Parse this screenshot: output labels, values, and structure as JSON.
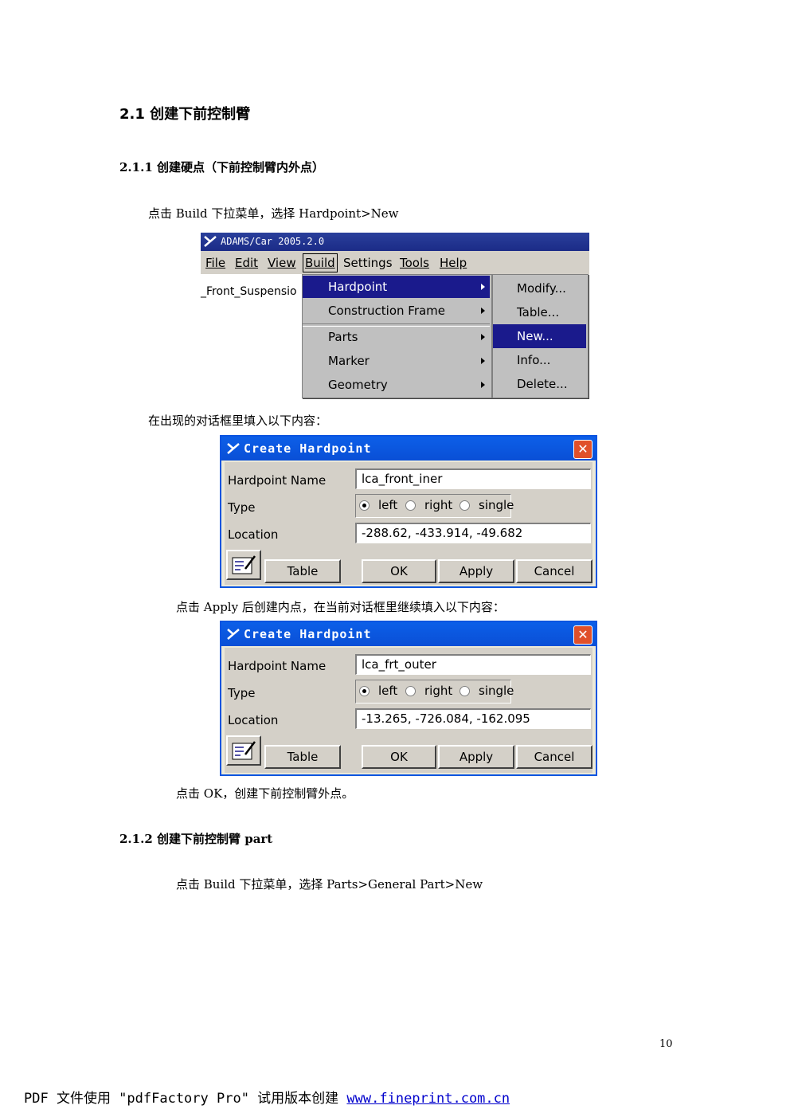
{
  "section": {
    "title": "2.1 创建下前控制臂"
  },
  "sub1": {
    "title": "2.1.1 创建硬点（下前控制臂内外点）",
    "instruction": "点击 Build 下拉菜单，选择 Hardpoint>New"
  },
  "menu_shot": {
    "window_title": "ADAMS/Car 2005.2.0",
    "menubar": [
      "File",
      "Edit",
      "View",
      "Build",
      "Settings",
      "Tools",
      "Help"
    ],
    "left_label": "_Front_Suspensio",
    "build_menu": [
      "Hardpoint",
      "Construction Frame",
      "Parts",
      "Marker",
      "Geometry"
    ],
    "hardpoint_submenu": [
      "Modify...",
      "Table...",
      "New...",
      "Info...",
      "Delete..."
    ]
  },
  "para_fill": "在出现的对话框里填入以下内容：",
  "dialog1": {
    "title": "Create Hardpoint",
    "close": "✕",
    "name_label": "Hardpoint Name",
    "name_value": "lca_front_iner",
    "type_label": "Type",
    "type_options": [
      "left",
      "right",
      "single"
    ],
    "type_selected": "left",
    "location_label": "Location",
    "location_value": "-288.62, -433.914, -49.682",
    "buttons": [
      "Table",
      "OK",
      "Apply",
      "Cancel"
    ]
  },
  "para_apply": "点击 Apply 后创建内点，在当前对话框里继续填入以下内容：",
  "dialog2": {
    "title": "Create Hardpoint",
    "close": "✕",
    "name_label": "Hardpoint Name",
    "name_value": "lca_frt_outer",
    "type_label": "Type",
    "type_options": [
      "left",
      "right",
      "single"
    ],
    "type_selected": "left",
    "location_label": "Location",
    "location_value": "-13.265, -726.084, -162.095",
    "buttons": [
      "Table",
      "OK",
      "Apply",
      "Cancel"
    ]
  },
  "para_ok": "点击 OK，创建下前控制臂外点。",
  "sub2": {
    "title": "2.1.2 创建下前控制臂 part",
    "instruction": "点击 Build 下拉菜单，选择 Parts>General Part>New"
  },
  "page_number": "10",
  "footer": {
    "text": "PDF 文件使用 \"pdfFactory Pro\" 试用版本创建",
    "link": "www.fineprint.com.cn"
  }
}
